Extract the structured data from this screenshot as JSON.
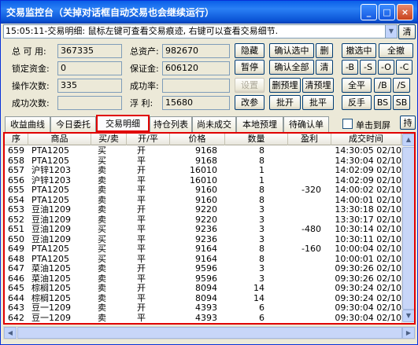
{
  "window": {
    "title": "交易监控台（关掉对话框自动交易也会继续运行）",
    "minimize": "_",
    "maximize": "□",
    "close": "×"
  },
  "message_bar": {
    "text": "15:05:11-交易明细: 鼠标左键可查看交易痕迹, 右键可以查看交易细节.",
    "clear_label": "清"
  },
  "account": {
    "available_label": "总 可 用:",
    "available_value": "367335",
    "total_assets_label": "总资产:",
    "total_assets_value": "982670",
    "locked_funds_label": "锁定资金:",
    "locked_funds_value": "0",
    "margin_label": "保证金:",
    "margin_value": "606120",
    "op_count_label": "操作次数:",
    "op_count_value": "335",
    "success_rate_label": "成功率:",
    "success_rate_value": "",
    "success_count_label": "成功次数:",
    "success_count_value": "",
    "floating_label": "浮  利:",
    "floating_value": "15680"
  },
  "buttons": {
    "hide": "隐藏",
    "pause": "暂停",
    "settings": "设置",
    "modify_params": "改参",
    "confirm_selected": "确认选中",
    "confirm_all": "确认全部",
    "delete_preset": "删预埋",
    "clear_preset": "清预埋",
    "batch_open": "批开",
    "batch_close": "批平",
    "delete": "删",
    "clear": "清",
    "cancel_selected": "撤选中",
    "cancel_all": "全撤",
    "minus_b": "-B",
    "minus_s": "-S",
    "minus_o": "-O",
    "minus_c": "-C",
    "close_all": "全平",
    "slash_b": "/B",
    "slash_s": "/S",
    "reverse": "反手",
    "bs": "BS",
    "sb": "SB"
  },
  "tabs": [
    "收益曲线",
    "今日委托",
    "交易明细",
    "持仓列表",
    "尚未成交",
    "本地预埋",
    "待确认单"
  ],
  "single_screen_label": "单击到屏",
  "more_tab": "持",
  "table": {
    "headers": [
      "序",
      "商品",
      "买/卖",
      "开/平",
      "价格",
      "数量",
      "盈利",
      "成交时间"
    ],
    "rows": [
      [
        "659",
        "PTA1205",
        "买",
        "开",
        "9168",
        "8",
        "",
        "14:30:05 02/10"
      ],
      [
        "658",
        "PTA1205",
        "买",
        "平",
        "9168",
        "8",
        "",
        "14:30:04 02/10"
      ],
      [
        "657",
        "沪锌1203",
        "卖",
        "开",
        "16010",
        "1",
        "",
        "14:02:09 02/10"
      ],
      [
        "656",
        "沪锌1203",
        "卖",
        "平",
        "16010",
        "1",
        "",
        "14:02:09 02/10"
      ],
      [
        "655",
        "PTA1205",
        "卖",
        "平",
        "9160",
        "8",
        "-320",
        "14:00:02 02/10"
      ],
      [
        "654",
        "PTA1205",
        "卖",
        "平",
        "9160",
        "8",
        "",
        "14:00:01 02/10"
      ],
      [
        "653",
        "豆油1209",
        "卖",
        "开",
        "9220",
        "3",
        "",
        "13:30:18 02/10"
      ],
      [
        "652",
        "豆油1209",
        "卖",
        "平",
        "9220",
        "3",
        "",
        "13:30:17 02/10"
      ],
      [
        "651",
        "豆油1209",
        "买",
        "平",
        "9236",
        "3",
        "-480",
        "10:30:14 02/10"
      ],
      [
        "650",
        "豆油1209",
        "买",
        "平",
        "9236",
        "3",
        "",
        "10:30:11 02/10"
      ],
      [
        "649",
        "PTA1205",
        "买",
        "平",
        "9164",
        "8",
        "-160",
        "10:00:04 02/10"
      ],
      [
        "648",
        "PTA1205",
        "买",
        "平",
        "9164",
        "8",
        "",
        "10:00:01 02/10"
      ],
      [
        "647",
        "菜油1205",
        "卖",
        "开",
        "9596",
        "3",
        "",
        "09:30:26 02/10"
      ],
      [
        "646",
        "菜油1205",
        "卖",
        "平",
        "9596",
        "3",
        "",
        "09:30:26 02/10"
      ],
      [
        "645",
        "棕榈1205",
        "卖",
        "开",
        "8094",
        "14",
        "",
        "09:30:24 02/10"
      ],
      [
        "644",
        "棕榈1205",
        "卖",
        "平",
        "8094",
        "14",
        "",
        "09:30:24 02/10"
      ],
      [
        "643",
        "豆一1209",
        "卖",
        "开",
        "4393",
        "6",
        "",
        "09:30:04 02/10"
      ],
      [
        "642",
        "豆一1209",
        "卖",
        "平",
        "4393",
        "6",
        "",
        "09:30:04 02/10"
      ]
    ]
  },
  "scroll_up": "▲",
  "scroll_down": "▼",
  "scroll_left": "◀",
  "scroll_right": "▶",
  "colors": {
    "highlight": "#e00000",
    "titlebar": "#0a5ee8"
  }
}
